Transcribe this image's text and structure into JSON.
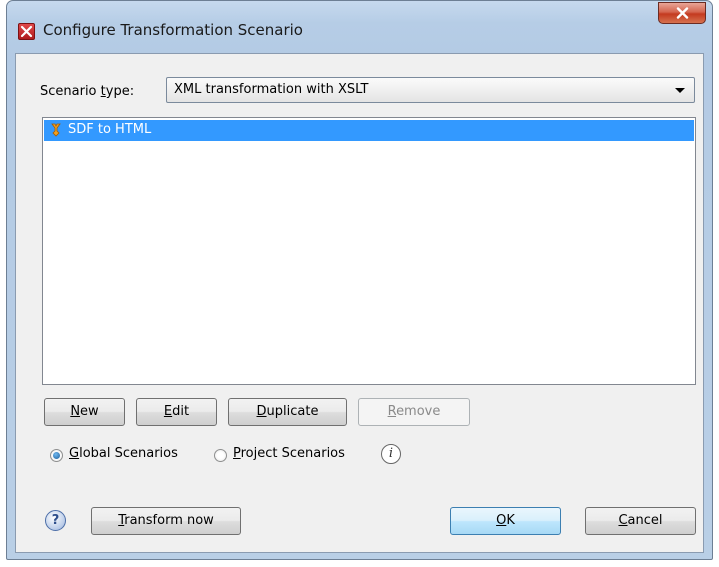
{
  "window": {
    "title": "Configure Transformation Scenario"
  },
  "scenario_type": {
    "label_prefix": "Scenario ",
    "label_mnemonic": "t",
    "label_suffix": "ype:",
    "value": "XML transformation with XSLT"
  },
  "scenarios": [
    {
      "name": "SDF to HTML",
      "selected": true
    }
  ],
  "buttons": {
    "new": {
      "mnemonic": "N",
      "rest": "ew"
    },
    "edit": {
      "mnemonic": "E",
      "rest": "dit"
    },
    "duplicate": {
      "mnemonic": "D",
      "rest": "uplicate"
    },
    "remove": {
      "mnemonic": "R",
      "rest": "emove",
      "enabled": false
    },
    "transform_now": {
      "mnemonic": "T",
      "rest": "ransform now"
    },
    "ok": {
      "mnemonic": "O",
      "rest": "K"
    },
    "cancel": {
      "mnemonic": "C",
      "rest": "ancel"
    }
  },
  "storage": {
    "global": {
      "mnemonic": "G",
      "rest": "lobal Scenarios",
      "checked": true
    },
    "project": {
      "mnemonic": "P",
      "rest": "roject Scenarios",
      "checked": false
    },
    "info_glyph": "i"
  },
  "help_glyph": "?",
  "colors": {
    "selection": "#3399ff",
    "close_button": "#c43a1f"
  }
}
